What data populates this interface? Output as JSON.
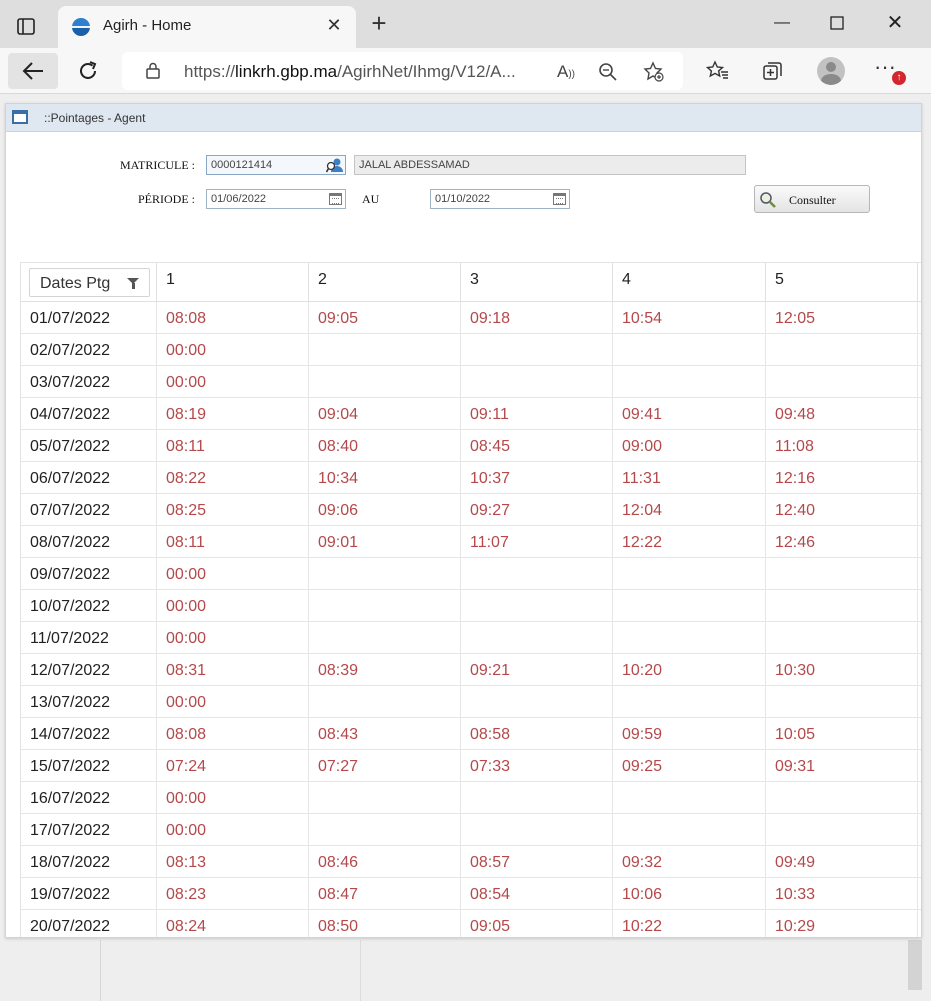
{
  "browser": {
    "tab_title": "Agirh - Home",
    "url_prefix": "https://",
    "url_host": "linkrh.gbp.ma",
    "url_path": "/AgirhNet/Ihmg/V12/A...",
    "update_badge": "↑"
  },
  "window": {
    "title": "::Pointages - Agent"
  },
  "form": {
    "matricule_label": "MATRICULE :",
    "matricule_value": "0000121414",
    "agent_name": "JALAL ABDESSAMAD",
    "periode_label": "PÉRIODE :",
    "periode_from": "01/06/2022",
    "au_label": "AU",
    "periode_to": "01/10/2022",
    "consult_label": "Consulter"
  },
  "grid": {
    "date_header": "Dates Ptg",
    "columns": [
      "1",
      "2",
      "3",
      "4",
      "5"
    ],
    "rows": [
      {
        "date": "01/07/2022",
        "t": [
          "08:08",
          "09:05",
          "09:18",
          "10:54",
          "12:05"
        ]
      },
      {
        "date": "02/07/2022",
        "t": [
          "00:00",
          "",
          "",
          "",
          ""
        ]
      },
      {
        "date": "03/07/2022",
        "t": [
          "00:00",
          "",
          "",
          "",
          ""
        ]
      },
      {
        "date": "04/07/2022",
        "t": [
          "08:19",
          "09:04",
          "09:11",
          "09:41",
          "09:48"
        ]
      },
      {
        "date": "05/07/2022",
        "t": [
          "08:11",
          "08:40",
          "08:45",
          "09:00",
          "11:08"
        ]
      },
      {
        "date": "06/07/2022",
        "t": [
          "08:22",
          "10:34",
          "10:37",
          "11:31",
          "12:16"
        ]
      },
      {
        "date": "07/07/2022",
        "t": [
          "08:25",
          "09:06",
          "09:27",
          "12:04",
          "12:40"
        ]
      },
      {
        "date": "08/07/2022",
        "t": [
          "08:11",
          "09:01",
          "11:07",
          "12:22",
          "12:46"
        ]
      },
      {
        "date": "09/07/2022",
        "t": [
          "00:00",
          "",
          "",
          "",
          ""
        ]
      },
      {
        "date": "10/07/2022",
        "t": [
          "00:00",
          "",
          "",
          "",
          ""
        ]
      },
      {
        "date": "11/07/2022",
        "t": [
          "00:00",
          "",
          "",
          "",
          ""
        ]
      },
      {
        "date": "12/07/2022",
        "t": [
          "08:31",
          "08:39",
          "09:21",
          "10:20",
          "10:30"
        ]
      },
      {
        "date": "13/07/2022",
        "t": [
          "00:00",
          "",
          "",
          "",
          ""
        ]
      },
      {
        "date": "14/07/2022",
        "t": [
          "08:08",
          "08:43",
          "08:58",
          "09:59",
          "10:05"
        ]
      },
      {
        "date": "15/07/2022",
        "t": [
          "07:24",
          "07:27",
          "07:33",
          "09:25",
          "09:31"
        ]
      },
      {
        "date": "16/07/2022",
        "t": [
          "00:00",
          "",
          "",
          "",
          ""
        ]
      },
      {
        "date": "17/07/2022",
        "t": [
          "00:00",
          "",
          "",
          "",
          ""
        ]
      },
      {
        "date": "18/07/2022",
        "t": [
          "08:13",
          "08:46",
          "08:57",
          "09:32",
          "09:49"
        ]
      },
      {
        "date": "19/07/2022",
        "t": [
          "08:23",
          "08:47",
          "08:54",
          "10:06",
          "10:33"
        ]
      },
      {
        "date": "20/07/2022",
        "t": [
          "08:24",
          "08:50",
          "09:05",
          "10:22",
          "10:29"
        ]
      }
    ]
  },
  "colors": {
    "time_text": "#b5484a",
    "header_bg": "#dfe8f1"
  }
}
